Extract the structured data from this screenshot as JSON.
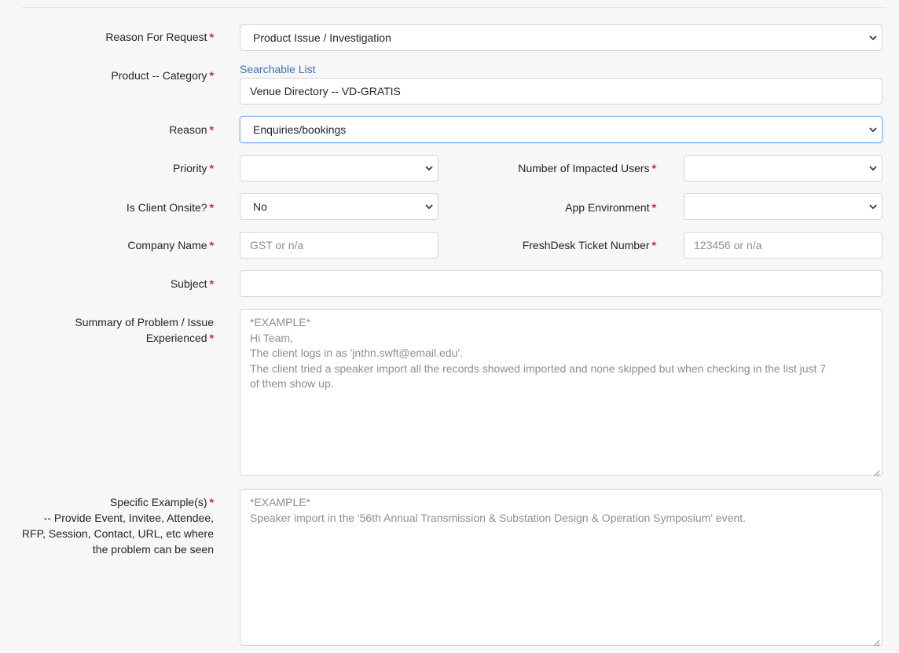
{
  "form": {
    "required_mark": "*",
    "reason_for_request": {
      "label": "Reason For Request",
      "value": "Product Issue / Investigation"
    },
    "product_category": {
      "label": "Product -- Category",
      "link": "Searchable List",
      "value": "Venue Directory -- VD-GRATIS"
    },
    "reason": {
      "label": "Reason",
      "value": "Enquiries/bookings"
    },
    "priority": {
      "label": "Priority",
      "value": ""
    },
    "impacted_users": {
      "label": "Number of Impacted Users",
      "value": ""
    },
    "client_onsite": {
      "label": "Is Client Onsite?",
      "value": "No"
    },
    "app_environment": {
      "label": "App Environment",
      "value": ""
    },
    "company_name": {
      "label": "Company Name",
      "value": "",
      "placeholder": "GST or n/a"
    },
    "freshdesk_ticket": {
      "label": "FreshDesk Ticket Number",
      "value": "",
      "placeholder": "123456 or n/a"
    },
    "subject": {
      "label": "Subject",
      "value": ""
    },
    "summary": {
      "label_line1": "Summary of Problem / Issue",
      "label_line2": "Experienced",
      "placeholder_lines": [
        "*EXAMPLE*",
        "Hi Team,",
        "The client logs in as 'jnthn.swft@email.edu'.",
        "The client tried a speaker import all the records showed imported and none skipped but when checking in the list just 7",
        "of them show up."
      ]
    },
    "examples": {
      "label_line1": "Specific Example(s)",
      "label_line2": "-- Provide Event, Invitee, Attendee,",
      "label_line3": "RFP, Session, Contact, URL, etc where",
      "label_line4": "the problem can be seen",
      "placeholder_lines": [
        "*EXAMPLE*",
        "Speaker import in the '56th Annual Transmission & Substation Design & Operation Symposium' event."
      ]
    }
  },
  "colors": {
    "required": "#d9232d",
    "link": "#3a73b8",
    "focus_border": "#86b7fe"
  },
  "icons": {
    "select_arrow": "chevron-down-icon",
    "resize": "resize-grip-icon"
  }
}
